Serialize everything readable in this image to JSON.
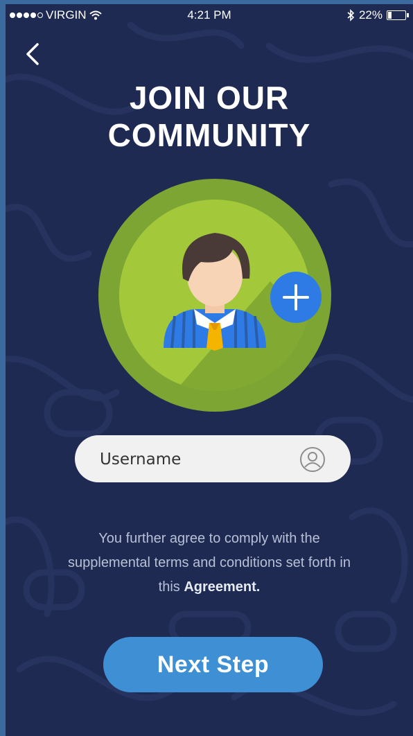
{
  "status_bar": {
    "carrier": "VIRGIN",
    "time": "4:21 PM",
    "battery": "22%",
    "battery_level": 0.22,
    "signal_bars": 4
  },
  "navigation": {
    "back_icon": "chevron-left-icon"
  },
  "header": {
    "title_line1": "JOIN OUR",
    "title_line2": "COMMUNITY"
  },
  "avatar": {
    "icon": "user-avatar-icon",
    "add_icon": "plus-icon"
  },
  "form": {
    "username_placeholder": "Username",
    "username_icon": "user-circle-icon"
  },
  "agreement": {
    "text": "You further agree to comply with the supplemental terms and conditions set forth in this",
    "link_text": "Agreement."
  },
  "actions": {
    "next_label": "Next Step"
  },
  "colors": {
    "background": "#1f2a52",
    "frame": "#3a6a9e",
    "avatar_outer": "#7da533",
    "avatar_inner": "#a3c93a",
    "add_button": "#2f7be6",
    "next_button": "#3e8fd4",
    "input_background": "#f1f1f1"
  }
}
